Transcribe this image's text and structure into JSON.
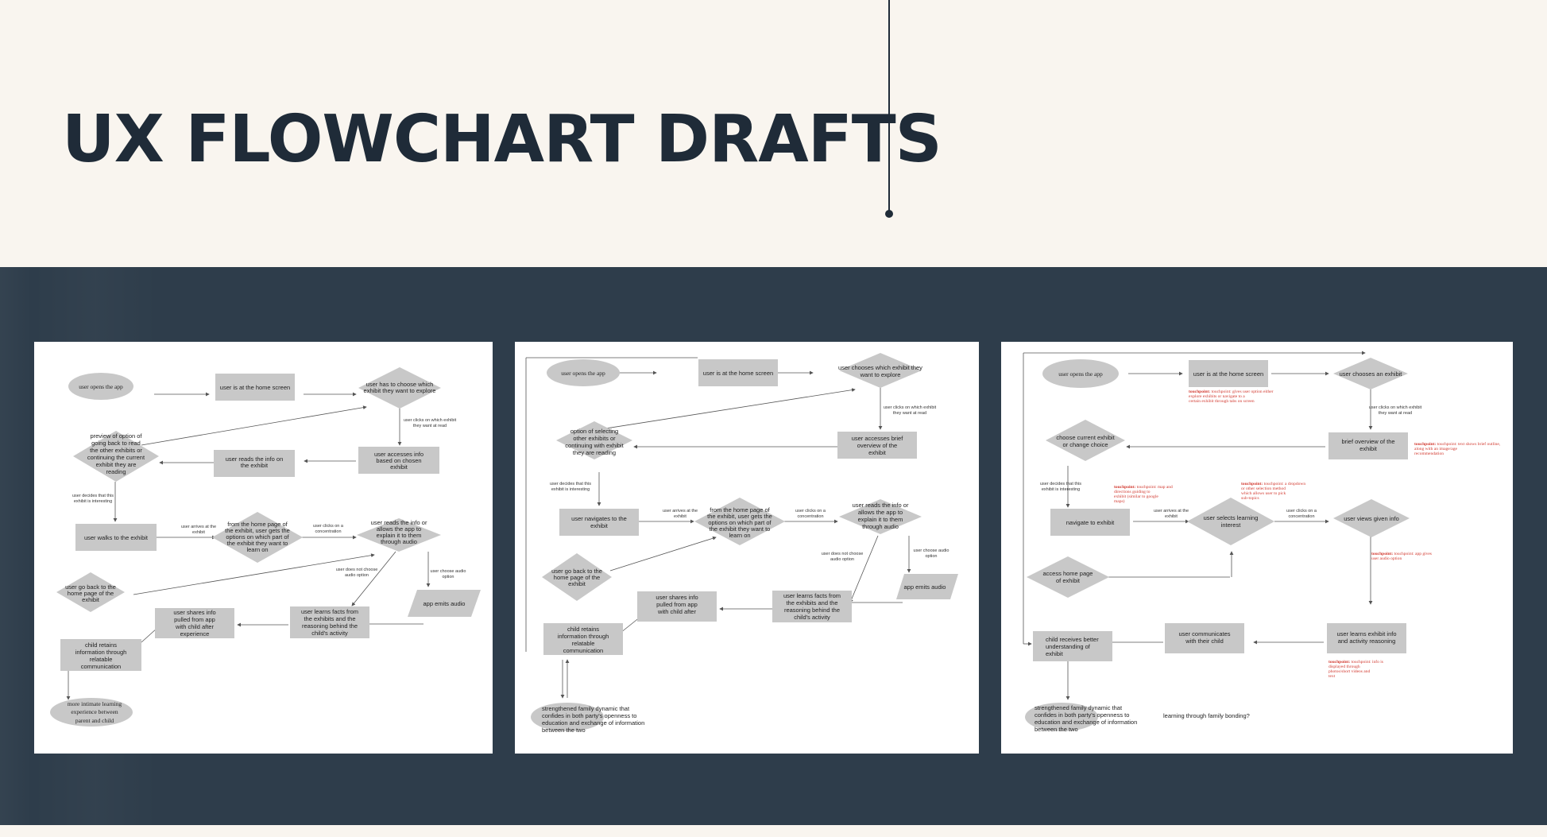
{
  "page": {
    "title": "UX FLOWCHART DRAFTS"
  },
  "colors": {
    "background": "#f9f5ef",
    "title": "#1f2b38",
    "band": "#2e3d4b",
    "node": "#c8c8c8",
    "touchpoint": "#d23a30"
  },
  "d1": {
    "n1": "user opens the app",
    "n2": "user is at the home screen",
    "n3": [
      "user has to choose which",
      "exhibit they want to explore"
    ],
    "l1": [
      "user clicks on which exhibit",
      "they want at read"
    ],
    "n4": [
      "user accesses info",
      "based on chosen",
      "exhibit"
    ],
    "n5": [
      "user reads the info on",
      "the exhibit"
    ],
    "n6": [
      "preview of option of",
      "going back to read",
      "the other exhibits or",
      "continuing the current",
      "exhibit they are",
      "reading"
    ],
    "l2": [
      "user decides that this",
      "exhibit is interesting"
    ],
    "n7": "user walks to the exhibit",
    "l3": [
      "user arrives at the",
      "exhibit"
    ],
    "n8": [
      "from the home page of",
      "the exhibit, user gets the",
      "options on which part of",
      "the exhibit they want to",
      "learn on"
    ],
    "l4": [
      "user clicks on a",
      "concentration"
    ],
    "n9": [
      "user reads the info or",
      "allows the app to",
      "explain it to them",
      "through audio"
    ],
    "l5": [
      "user does not choose",
      "audio option"
    ],
    "l6": [
      "user choose audio",
      "option"
    ],
    "n10": "app emits audio",
    "n11": [
      "user go back to the",
      "home page of the",
      "exhibit"
    ],
    "n12": [
      "user learns facts from",
      "the exhibits and the",
      "reasoning behind the",
      "child's activity"
    ],
    "n13": [
      "user shares info",
      "pulled from app",
      "with child after",
      "experience"
    ],
    "n14": [
      "child retains",
      "information through",
      "relatable",
      "communication"
    ],
    "n15": [
      "more intimate learning",
      "experience between",
      "parent and child"
    ]
  },
  "d2": {
    "n1": "user opens the app",
    "n2": "user is at the home screen",
    "n3": [
      "user chooses which exhibit they",
      "want to explore"
    ],
    "l1": [
      "user clicks on which exhibit",
      "they want at read"
    ],
    "n4": [
      "user accesses brief",
      "overview of the",
      "exhibit"
    ],
    "n6": [
      "option of selecting",
      "other exhibits or",
      "continuing with exhibit",
      "they are reading"
    ],
    "l2": [
      "user decides that this",
      "exhibit is interesting"
    ],
    "n7": [
      "user navigates to the",
      "exhibit"
    ],
    "l3": [
      "user arrives at the",
      "exhibit"
    ],
    "n8": [
      "from the home page of",
      "the exhibit, user gets the",
      "options on which part of",
      "the exhibit they want to",
      "learn on"
    ],
    "l4": [
      "user clicks on a",
      "concentration"
    ],
    "n9": [
      "user reads the info or",
      "allows the app to",
      "explain it to them",
      "through audio"
    ],
    "l5": [
      "user does not choose",
      "audio option"
    ],
    "l6": [
      "user choose audio",
      "option"
    ],
    "n10": "app emits audio",
    "n11": [
      "user go back to the",
      "home page of the",
      "exhibit"
    ],
    "n12": [
      "user learns facts from",
      "the exhibits and the",
      "reasoning behind the",
      "child's activity"
    ],
    "n13": [
      "user shares info",
      "pulled from app",
      "with child after",
      "experience"
    ],
    "n14": [
      "child retains",
      "information through",
      "relatable",
      "communication"
    ],
    "n15": [
      "strengthened family dynamic that",
      "confides in both party's openness to",
      "education and exchange of information",
      "between the two"
    ]
  },
  "d3": {
    "n1": "user opens the app",
    "n2": "user is at the home screen",
    "tp1": [
      "touchpoint: gives user option either",
      "explore exhibits or navigate to a",
      "certain exhibit through tabs on screen"
    ],
    "n3": "user chooses an exhibit",
    "l1": [
      "user clicks on which exhibit",
      "they want at read"
    ],
    "n4": [
      "brief overview of the",
      "exhibit"
    ],
    "tp2": [
      "touchpoint: text shows brief outline,",
      "along with an image/age",
      "recommendation"
    ],
    "n6": [
      "choose current exhibit",
      "or change choice"
    ],
    "l2": [
      "user decides that this",
      "exhibit is interesting"
    ],
    "tp3": [
      "touchpoint: map and",
      "directions guiding to",
      "exhibit (similar to google",
      "maps)"
    ],
    "tp4": [
      "touchpoint: a dropdown",
      "or other selection method",
      "which allows user to pick",
      "sub-topics"
    ],
    "n7": "navigate to exhibit",
    "l3": [
      "user arrives at the",
      "exhibit"
    ],
    "n8": [
      "user selects learning",
      "interest"
    ],
    "l4": [
      "user clicks on a",
      "concentration"
    ],
    "n9": "user views given info",
    "tp5": [
      "touchpoint: app gives",
      "user audio option"
    ],
    "n11": [
      "access home page",
      "of exhibit"
    ],
    "n12": [
      "user learns exhibit info",
      "and activity reasoning"
    ],
    "tp6": [
      "touchpoint: info is",
      "displayed through",
      "photos/short videos and",
      "text"
    ],
    "n13": [
      "user communicates",
      "with their child"
    ],
    "n14": [
      "child receives better",
      "understanding of",
      "exhibit"
    ],
    "n15": [
      "strengthened family dynamic that",
      "confides in both party's openness to",
      "education and exchange of information",
      "between the two"
    ],
    "q": "learning through family bonding?"
  }
}
